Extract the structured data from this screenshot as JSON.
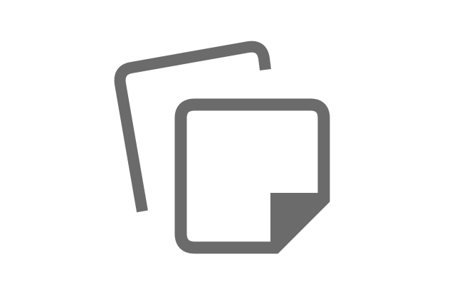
{
  "icon": {
    "name": "sticky-notes-icon",
    "color": "#6b6b6c",
    "background": "#ffffff"
  }
}
